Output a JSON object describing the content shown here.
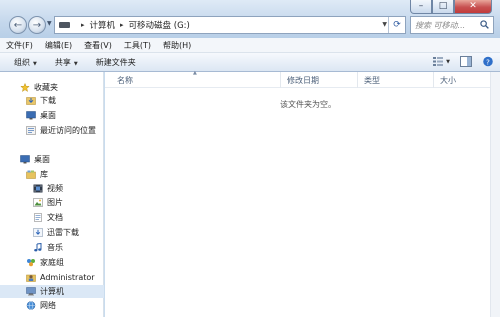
{
  "window": {
    "minimize_glyph": "–",
    "maximize_glyph": "□",
    "close_glyph": "✕"
  },
  "nav": {
    "back_glyph": "←",
    "forward_glyph": "→"
  },
  "address": {
    "crumbs": [
      "计算机",
      "可移动磁盘 (G:)"
    ],
    "separator": "▸"
  },
  "search": {
    "placeholder": "搜索 可移动..."
  },
  "menu": [
    "文件(F)",
    "编辑(E)",
    "查看(V)",
    "工具(T)",
    "帮助(H)"
  ],
  "toolbar": {
    "organize": "组织",
    "share": "共享",
    "new_folder": "新建文件夹"
  },
  "sidebar": {
    "items": [
      {
        "label": "收藏夹",
        "icon": "star-icon"
      },
      {
        "label": "下载",
        "icon": "download-folder-icon"
      },
      {
        "label": "桌面",
        "icon": "desktop-icon"
      },
      {
        "label": "最近访问的位置",
        "icon": "recent-places-icon"
      },
      {
        "label": "桌面",
        "icon": "desktop-icon"
      },
      {
        "label": "库",
        "icon": "library-icon"
      },
      {
        "label": "视频",
        "icon": "video-icon"
      },
      {
        "label": "图片",
        "icon": "pictures-icon"
      },
      {
        "label": "文档",
        "icon": "documents-icon"
      },
      {
        "label": "迅雷下载",
        "icon": "thunder-download-icon"
      },
      {
        "label": "音乐",
        "icon": "music-icon"
      },
      {
        "label": "家庭组",
        "icon": "homegroup-icon"
      },
      {
        "label": "Administrator",
        "icon": "user-icon"
      },
      {
        "label": "计算机",
        "icon": "computer-icon"
      },
      {
        "label": "网络",
        "icon": "network-icon"
      }
    ]
  },
  "columns": [
    "名称",
    "修改日期",
    "类型",
    "大小"
  ],
  "empty_message": "该文件夹为空。",
  "colors": {
    "chrome": "#c9dcee",
    "selection": "#dbe8f6",
    "header_text": "#4c607a"
  }
}
